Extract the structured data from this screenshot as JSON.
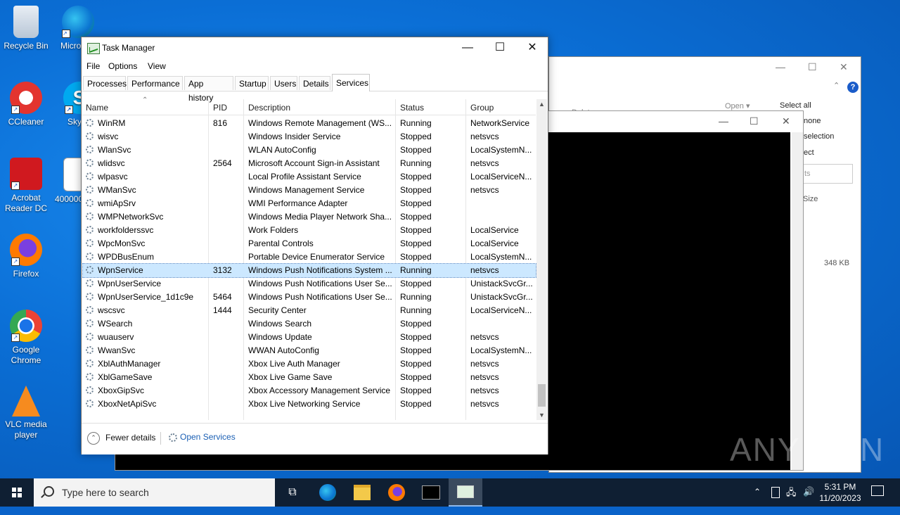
{
  "desktop": {
    "icons": [
      {
        "label": "Recycle Bin"
      },
      {
        "label": "Micro Edg"
      },
      {
        "label": "CCleaner"
      },
      {
        "label": "Sky"
      },
      {
        "label": "Acrobat Reader DC"
      },
      {
        "label": "400000"
      },
      {
        "label": "Firefox"
      },
      {
        "label": "Google Chrome"
      },
      {
        "label": "VLC media player"
      }
    ]
  },
  "explorer": {
    "ribbon": {
      "delete": "Delete ▾",
      "open": "Open ▾",
      "select_all": "Select all",
      "select_none": "none",
      "invert": "selection",
      "select_label": "ect"
    },
    "search_placeholder": "ts",
    "size_header": "Size",
    "size_value": "348 KB"
  },
  "task_manager": {
    "title": "Task Manager",
    "menu": [
      "File",
      "Options",
      "View"
    ],
    "tabs": [
      "Processes",
      "Performance",
      "App history",
      "Startup",
      "Users",
      "Details",
      "Services"
    ],
    "active_tab": "Services",
    "columns": [
      "Name",
      "PID",
      "Description",
      "Status",
      "Group"
    ],
    "rows": [
      {
        "name": "WinRM",
        "pid": "816",
        "desc": "Windows Remote Management (WS...",
        "status": "Running",
        "group": "NetworkService"
      },
      {
        "name": "wisvc",
        "pid": "",
        "desc": "Windows Insider Service",
        "status": "Stopped",
        "group": "netsvcs"
      },
      {
        "name": "WlanSvc",
        "pid": "",
        "desc": "WLAN AutoConfig",
        "status": "Stopped",
        "group": "LocalSystemN..."
      },
      {
        "name": "wlidsvc",
        "pid": "2564",
        "desc": "Microsoft Account Sign-in Assistant",
        "status": "Running",
        "group": "netsvcs"
      },
      {
        "name": "wlpasvc",
        "pid": "",
        "desc": "Local Profile Assistant Service",
        "status": "Stopped",
        "group": "LocalServiceN..."
      },
      {
        "name": "WManSvc",
        "pid": "",
        "desc": "Windows Management Service",
        "status": "Stopped",
        "group": "netsvcs"
      },
      {
        "name": "wmiApSrv",
        "pid": "",
        "desc": "WMI Performance Adapter",
        "status": "Stopped",
        "group": ""
      },
      {
        "name": "WMPNetworkSvc",
        "pid": "",
        "desc": "Windows Media Player Network Sha...",
        "status": "Stopped",
        "group": ""
      },
      {
        "name": "workfolderssvc",
        "pid": "",
        "desc": "Work Folders",
        "status": "Stopped",
        "group": "LocalService"
      },
      {
        "name": "WpcMonSvc",
        "pid": "",
        "desc": "Parental Controls",
        "status": "Stopped",
        "group": "LocalService"
      },
      {
        "name": "WPDBusEnum",
        "pid": "",
        "desc": "Portable Device Enumerator Service",
        "status": "Stopped",
        "group": "LocalSystemN..."
      },
      {
        "name": "WpnService",
        "pid": "3132",
        "desc": "Windows Push Notifications System ...",
        "status": "Running",
        "group": "netsvcs"
      },
      {
        "name": "WpnUserService",
        "pid": "",
        "desc": "Windows Push Notifications User Se...",
        "status": "Stopped",
        "group": "UnistackSvcGr..."
      },
      {
        "name": "WpnUserService_1d1c9e",
        "pid": "5464",
        "desc": "Windows Push Notifications User Se...",
        "status": "Running",
        "group": "UnistackSvcGr..."
      },
      {
        "name": "wscsvc",
        "pid": "1444",
        "desc": "Security Center",
        "status": "Running",
        "group": "LocalServiceN..."
      },
      {
        "name": "WSearch",
        "pid": "",
        "desc": "Windows Search",
        "status": "Stopped",
        "group": ""
      },
      {
        "name": "wuauserv",
        "pid": "",
        "desc": "Windows Update",
        "status": "Stopped",
        "group": "netsvcs"
      },
      {
        "name": "WwanSvc",
        "pid": "",
        "desc": "WWAN AutoConfig",
        "status": "Stopped",
        "group": "LocalSystemN..."
      },
      {
        "name": "XblAuthManager",
        "pid": "",
        "desc": "Xbox Live Auth Manager",
        "status": "Stopped",
        "group": "netsvcs"
      },
      {
        "name": "XblGameSave",
        "pid": "",
        "desc": "Xbox Live Game Save",
        "status": "Stopped",
        "group": "netsvcs"
      },
      {
        "name": "XboxGipSvc",
        "pid": "",
        "desc": "Xbox Accessory Management Service",
        "status": "Stopped",
        "group": "netsvcs"
      },
      {
        "name": "XboxNetApiSvc",
        "pid": "",
        "desc": "Xbox Live Networking Service",
        "status": "Stopped",
        "group": "netsvcs"
      }
    ],
    "selected_row": "WpnService",
    "footer": {
      "fewer_details": "Fewer details",
      "open_services": "Open Services"
    }
  },
  "taskbar": {
    "search_placeholder": "Type here to search",
    "time": "5:31 PM",
    "date": "11/20/2023"
  },
  "watermark": "ANY RUN",
  "colors": {
    "accent": "#0078d7",
    "selection": "#cce8ff",
    "taskbar": "#0f1f33"
  }
}
